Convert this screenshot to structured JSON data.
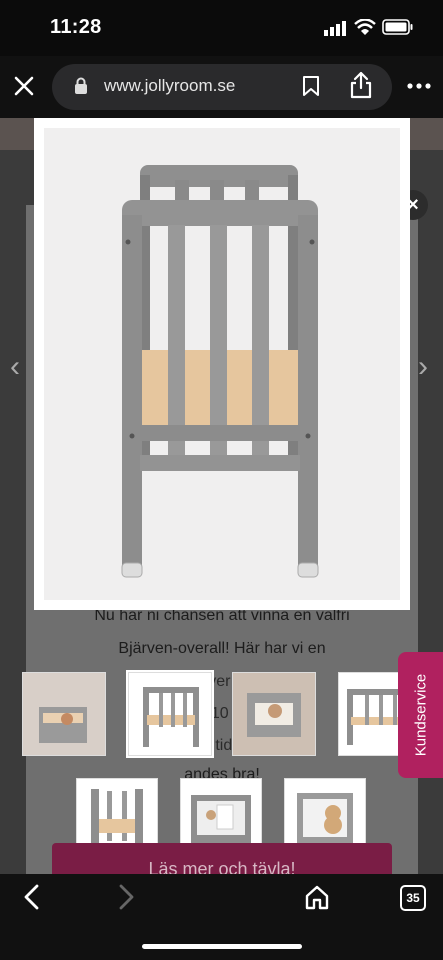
{
  "status_bar": {
    "time": "11:28"
  },
  "browser": {
    "url": "www.jollyroom.se",
    "tabs_count": "35"
  },
  "page": {
    "text_lines": [
      "Nu har ni chansen att vinna en valfri",
      "Bjärven-overall! Här har vi en",
      "stv                     ver                    mju",
      "adi                 10                     och",
      "enta                 tid                    ater",
      "andes bra!"
    ],
    "cta_label": "Läs mer och tävla!",
    "kundservice_label": "Kundservice"
  },
  "gallery": {
    "thumbnail_count_row1": 5,
    "thumbnail_count_row2": 3,
    "selected_index": 1
  },
  "colors": {
    "accent": "#b0215f",
    "cta": "#7a1d45",
    "crib_gray": "#8e8e8e",
    "mattress": "#e7c9a2"
  }
}
